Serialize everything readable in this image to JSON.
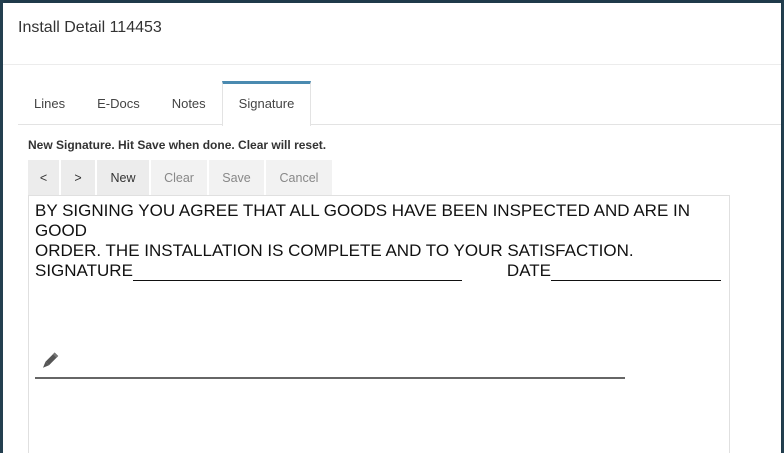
{
  "dialog": {
    "title": "Install Detail 114453"
  },
  "tabs": [
    {
      "label": "Lines",
      "active": false
    },
    {
      "label": "E-Docs",
      "active": false
    },
    {
      "label": "Notes",
      "active": false
    },
    {
      "label": "Signature",
      "active": true
    }
  ],
  "signature": {
    "instructions": "New Signature. Hit Save when done. Clear will reset.",
    "toolbar": {
      "prev_label": "<",
      "next_label": ">",
      "new_label": "New",
      "clear_label": "Clear",
      "save_label": "Save",
      "cancel_label": "Cancel"
    },
    "agreement_line1": "BY SIGNING YOU AGREE THAT ALL GOODS HAVE BEEN INSPECTED AND ARE IN GOOD",
    "agreement_line2": "ORDER. THE INSTALLATION IS COMPLETE AND TO YOUR SATISFACTION.",
    "signature_label": "SIGNATURE",
    "date_label": "DATE",
    "pen_icon": "pencil-icon"
  },
  "colors": {
    "accent": "#4a8ab0",
    "backdrop": "#1f3a4a"
  }
}
